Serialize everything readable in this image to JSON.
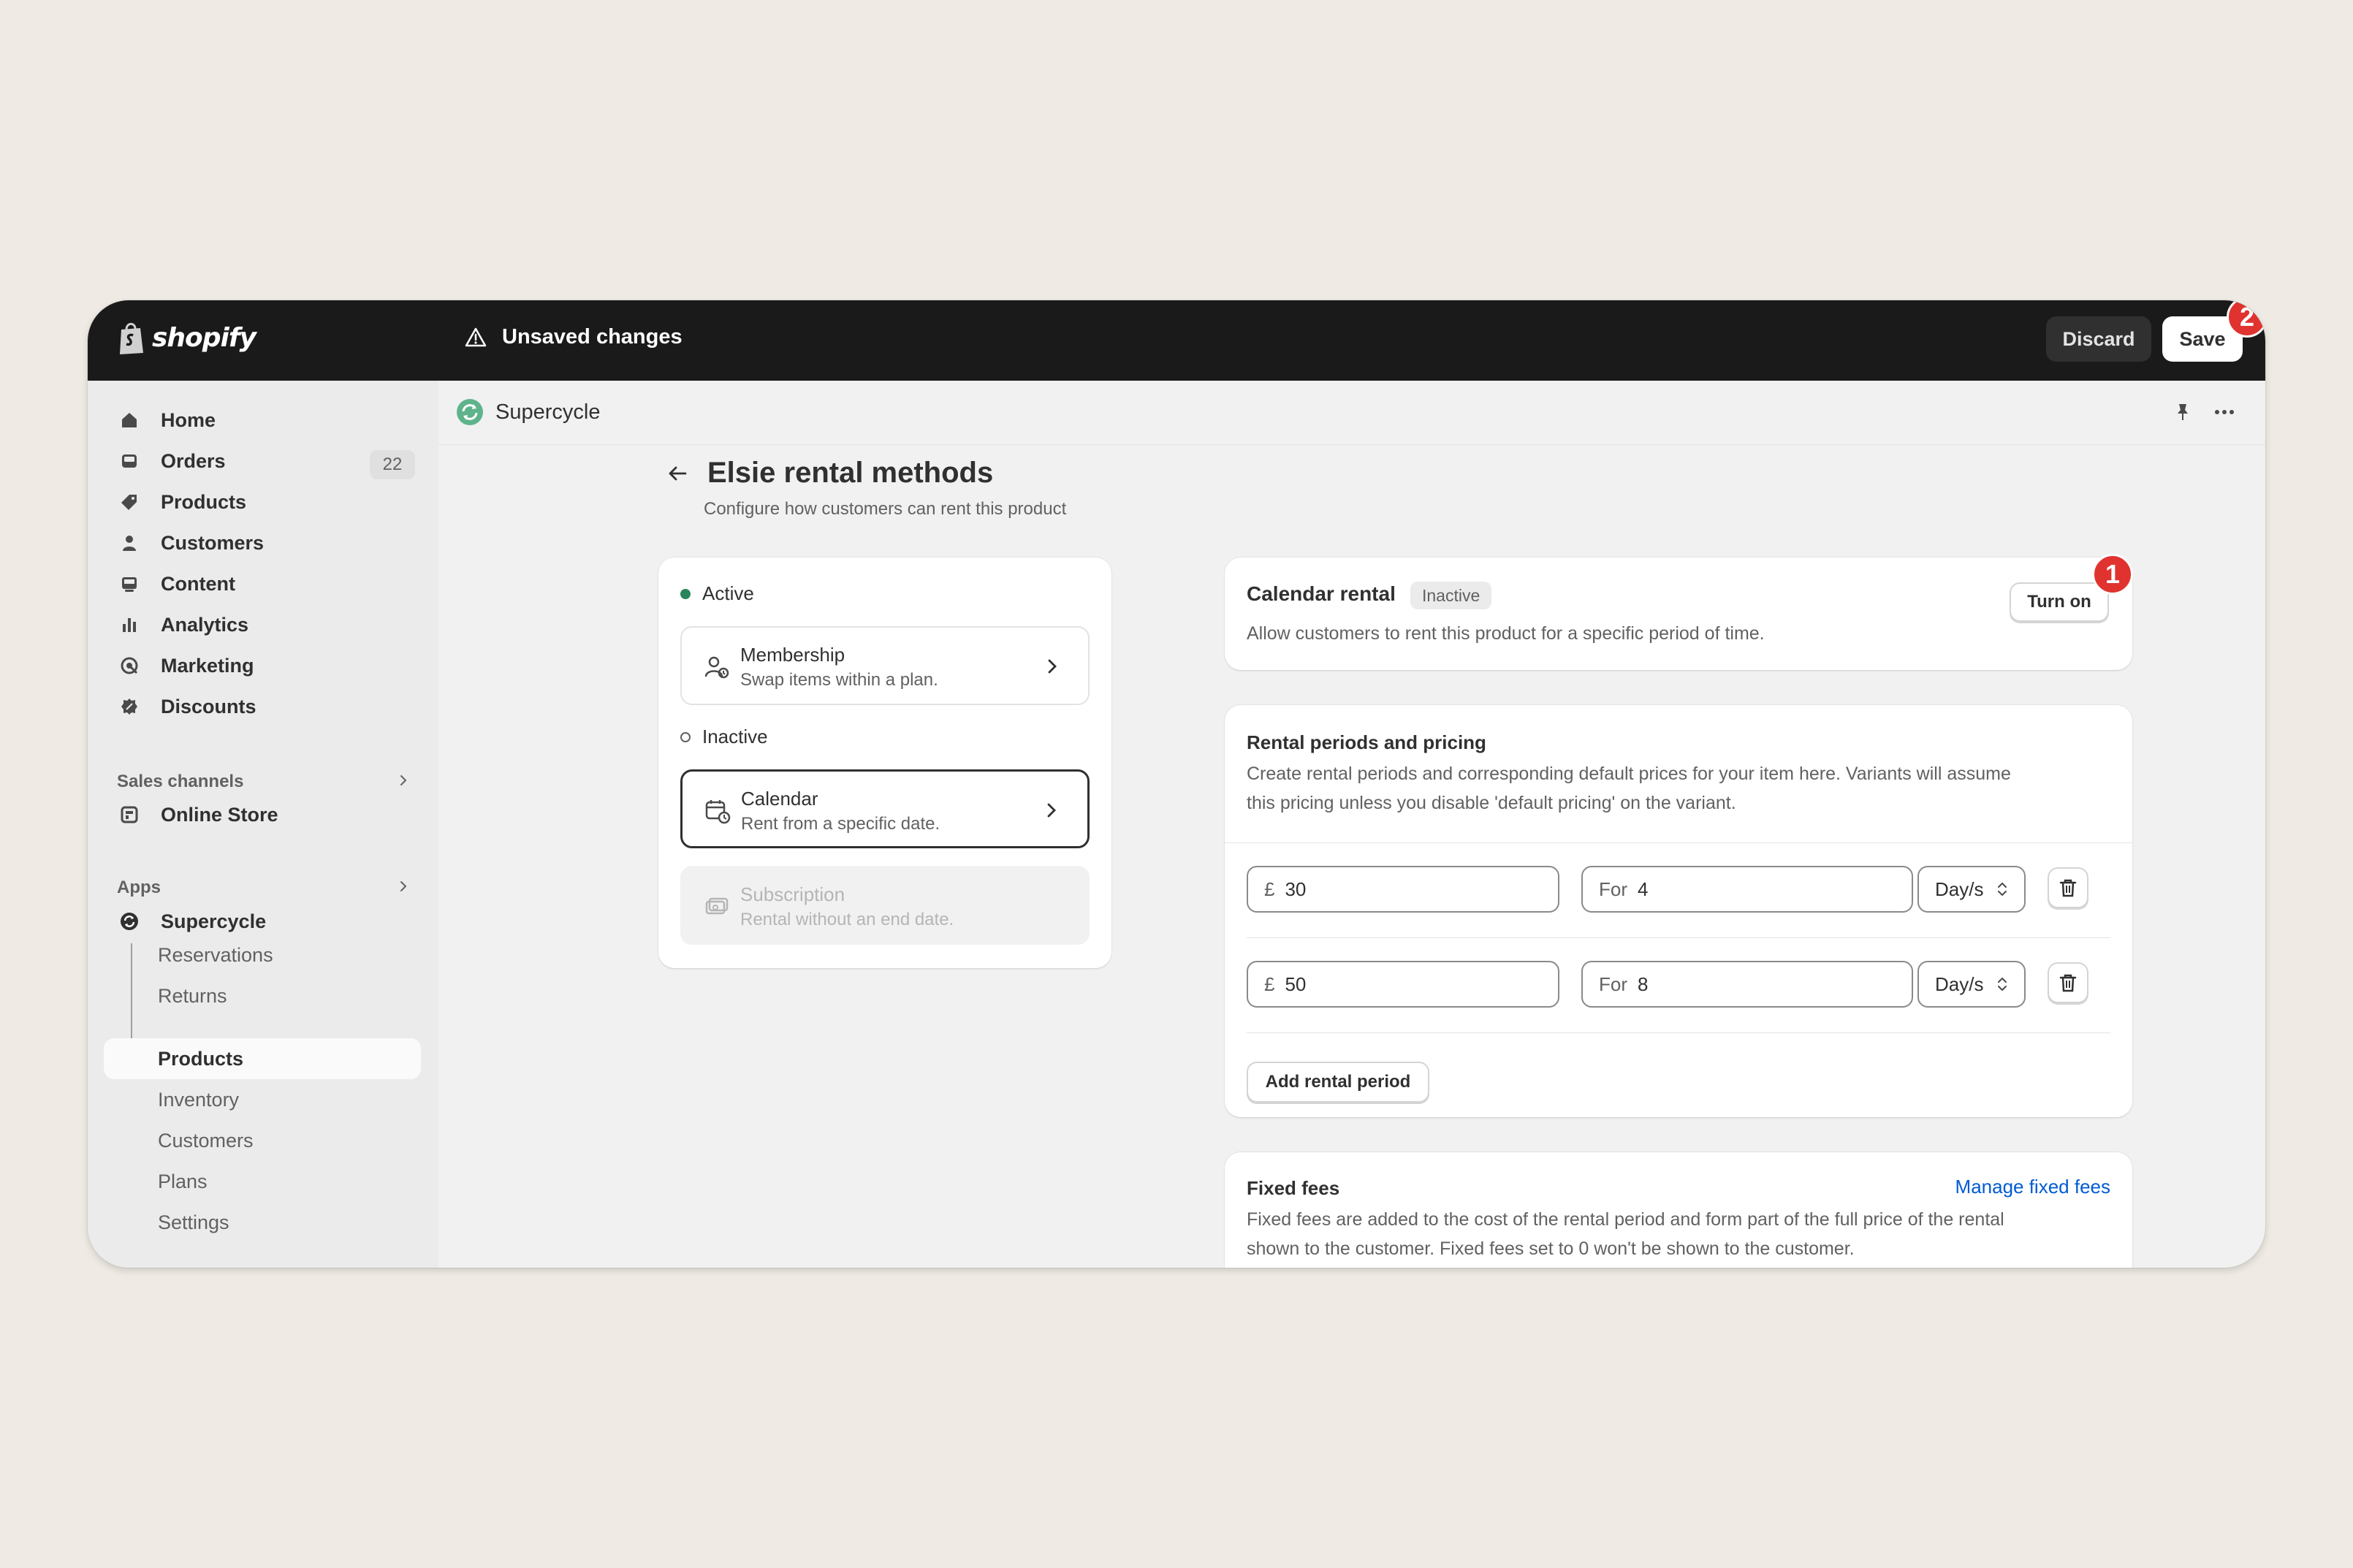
{
  "topbar": {
    "logo_text": "shopify",
    "unsaved_label": "Unsaved changes",
    "discard_label": "Discard",
    "save_label": "Save",
    "save_badge": "2"
  },
  "sidebar": {
    "items": [
      {
        "label": "Home",
        "icon": "home-icon"
      },
      {
        "label": "Orders",
        "icon": "orders-icon",
        "count": "22"
      },
      {
        "label": "Products",
        "icon": "tag-icon"
      },
      {
        "label": "Customers",
        "icon": "person-icon"
      },
      {
        "label": "Content",
        "icon": "content-icon"
      },
      {
        "label": "Analytics",
        "icon": "bar-chart-icon"
      },
      {
        "label": "Marketing",
        "icon": "target-icon"
      },
      {
        "label": "Discounts",
        "icon": "discount-icon"
      }
    ],
    "sales_channels_label": "Sales channels",
    "online_store_label": "Online Store",
    "apps_label": "Apps",
    "app_name": "Supercycle",
    "app_subitems": [
      "Reservations",
      "Returns",
      "Products",
      "Inventory",
      "Customers",
      "Plans",
      "Settings"
    ],
    "selected_subitem": "Products"
  },
  "app_header": {
    "name": "Supercycle"
  },
  "page": {
    "title": "Elsie rental methods",
    "subtitle": "Configure how customers can rent this product"
  },
  "methods": {
    "active_label": "Active",
    "inactive_label": "Inactive",
    "membership": {
      "title": "Membership",
      "desc": "Swap items within a plan."
    },
    "calendar": {
      "title": "Calendar",
      "desc": "Rent from a specific date."
    },
    "subscription": {
      "title": "Subscription",
      "desc": "Rental without an end date."
    }
  },
  "calendar_card": {
    "title": "Calendar rental",
    "status": "Inactive",
    "description": "Allow customers to rent this product for a specific period of time.",
    "turn_on_label": "Turn on",
    "badge": "1"
  },
  "periods_card": {
    "title": "Rental periods and pricing",
    "description_line1": "Create rental periods and corresponding default prices for your item here. Variants will assume",
    "description_line2": "this pricing unless you disable 'default pricing' on the variant.",
    "currency_symbol": "£",
    "for_prefix": "For",
    "rows": [
      {
        "price": "30",
        "duration": "4",
        "unit": "Day/s"
      },
      {
        "price": "50",
        "duration": "8",
        "unit": "Day/s"
      }
    ],
    "add_label": "Add rental period"
  },
  "fees_card": {
    "title": "Fixed fees",
    "link_label": "Manage fixed fees",
    "description_line1": "Fixed fees are added to the cost of the rental period and form part of the full price of the rental",
    "description_line2": "shown to the customer. Fixed fees set to 0 won't be shown to the customer."
  }
}
